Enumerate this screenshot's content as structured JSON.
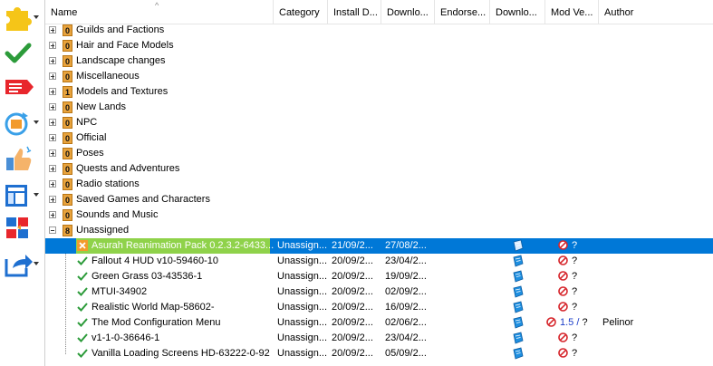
{
  "columns": {
    "name": "Name",
    "category": "Category",
    "install_date": "Install D...",
    "download_date": "Downlo...",
    "endorsement": "Endorse...",
    "download": "Downlo...",
    "mod_version": "Mod Ve...",
    "author": "Author"
  },
  "categories": [
    {
      "count": "0",
      "label": "Guilds and Factions"
    },
    {
      "count": "0",
      "label": "Hair and Face Models"
    },
    {
      "count": "0",
      "label": "Landscape changes"
    },
    {
      "count": "0",
      "label": "Miscellaneous"
    },
    {
      "count": "1",
      "label": "Models and Textures"
    },
    {
      "count": "0",
      "label": "New Lands"
    },
    {
      "count": "0",
      "label": "NPC"
    },
    {
      "count": "0",
      "label": "Official"
    },
    {
      "count": "0",
      "label": "Poses"
    },
    {
      "count": "0",
      "label": "Quests and Adventures"
    },
    {
      "count": "0",
      "label": "Radio stations"
    },
    {
      "count": "0",
      "label": "Saved Games and Characters"
    },
    {
      "count": "0",
      "label": "Sounds and Music"
    }
  ],
  "unassigned": {
    "count": "8",
    "label": "Unassigned"
  },
  "mods": [
    {
      "name": "Asurah Reanimation Pack 0.2.3.2-6433...",
      "category": "Unassign...",
      "install": "21/09/2...",
      "download": "27/08/2...",
      "version": "?",
      "author": "",
      "status": "error",
      "selected": true
    },
    {
      "name": "Fallout 4 HUD v10-59460-10",
      "category": "Unassign...",
      "install": "20/09/2...",
      "download": "23/04/2...",
      "version": "?",
      "author": "",
      "status": "ok"
    },
    {
      "name": "Green Grass 03-43536-1",
      "category": "Unassign...",
      "install": "20/09/2...",
      "download": "19/09/2...",
      "version": "?",
      "author": "",
      "status": "ok"
    },
    {
      "name": "MTUI-34902",
      "category": "Unassign...",
      "install": "20/09/2...",
      "download": "02/09/2...",
      "version": "?",
      "author": "",
      "status": "ok"
    },
    {
      "name": "Realistic World Map-58602-",
      "category": "Unassign...",
      "install": "20/09/2...",
      "download": "16/09/2...",
      "version": "?",
      "author": "",
      "status": "ok"
    },
    {
      "name": "The Mod Configuration Menu",
      "category": "Unassign...",
      "install": "20/09/2...",
      "download": "02/06/2...",
      "version_current": "1.5",
      "version_sep": " / ",
      "version": "?",
      "author": "Pelinor",
      "status": "ok"
    },
    {
      "name": "v1-1-0-36646-1",
      "category": "Unassign...",
      "install": "20/09/2...",
      "download": "23/04/2...",
      "version": "?",
      "author": "",
      "status": "ok"
    },
    {
      "name": "Vanilla Loading Screens HD-63222-0-92",
      "category": "Unassign...",
      "install": "20/09/2...",
      "download": "05/09/2...",
      "version": "?",
      "author": "",
      "status": "ok"
    }
  ],
  "toolbar_icons": [
    "puzzle-icon",
    "checkmark-icon",
    "tag-icon",
    "refresh-icon",
    "endorse-icon",
    "layout-icon",
    "categories-icon",
    "export-icon"
  ]
}
